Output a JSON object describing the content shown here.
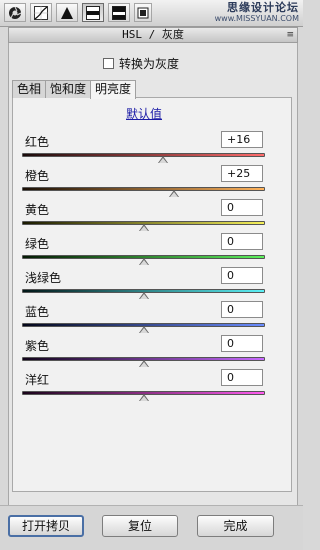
{
  "toolbar": {
    "tools": [
      {
        "icon": "aperture-icon",
        "active": false
      },
      {
        "icon": "tone-curve-icon",
        "active": false
      },
      {
        "icon": "sharpen-triangle-icon",
        "active": false
      },
      {
        "icon": "hsl-grayscale-icon",
        "active": true
      },
      {
        "icon": "split-toning-icon",
        "active": false
      },
      {
        "icon": "lens-corrections-icon",
        "active": false
      }
    ],
    "watermark_line1": "思缘设计论坛",
    "watermark_line2": "www.MISSYUAN.COM"
  },
  "panel": {
    "title": "HSL / 灰度",
    "menu_icon": "≡",
    "convert_gray_label": "转换为灰度",
    "convert_gray_checked": false,
    "tabs": [
      {
        "label": "色相",
        "active": false
      },
      {
        "label": "饱和度",
        "active": false
      },
      {
        "label": "明亮度",
        "active": true
      }
    ],
    "default_link": "默认值",
    "sliders": [
      {
        "label": "红色",
        "value": "+16",
        "numeric": 16,
        "gradient": [
          "#1a0a0a",
          "#ff6b6b"
        ]
      },
      {
        "label": "橙色",
        "value": "+25",
        "numeric": 25,
        "gradient": [
          "#1a0f05",
          "#ffb35c"
        ]
      },
      {
        "label": "黄色",
        "value": "0",
        "numeric": 0,
        "gradient": [
          "#1a1a00",
          "#f5f05a"
        ]
      },
      {
        "label": "绿色",
        "value": "0",
        "numeric": 0,
        "gradient": [
          "#031a03",
          "#5cf05c"
        ]
      },
      {
        "label": "浅绿色",
        "value": "0",
        "numeric": 0,
        "gradient": [
          "#021718",
          "#5cf0f5"
        ]
      },
      {
        "label": "蓝色",
        "value": "0",
        "numeric": 0,
        "gradient": [
          "#03061a",
          "#6a8cff"
        ]
      },
      {
        "label": "紫色",
        "value": "0",
        "numeric": 0,
        "gradient": [
          "#10031a",
          "#c86aff"
        ]
      },
      {
        "label": "洋红",
        "value": "0",
        "numeric": 0,
        "gradient": [
          "#1a031a",
          "#ff5cf0"
        ]
      }
    ]
  },
  "footer": {
    "open_copy": "打开拷贝",
    "reset": "复位",
    "done": "完成"
  }
}
